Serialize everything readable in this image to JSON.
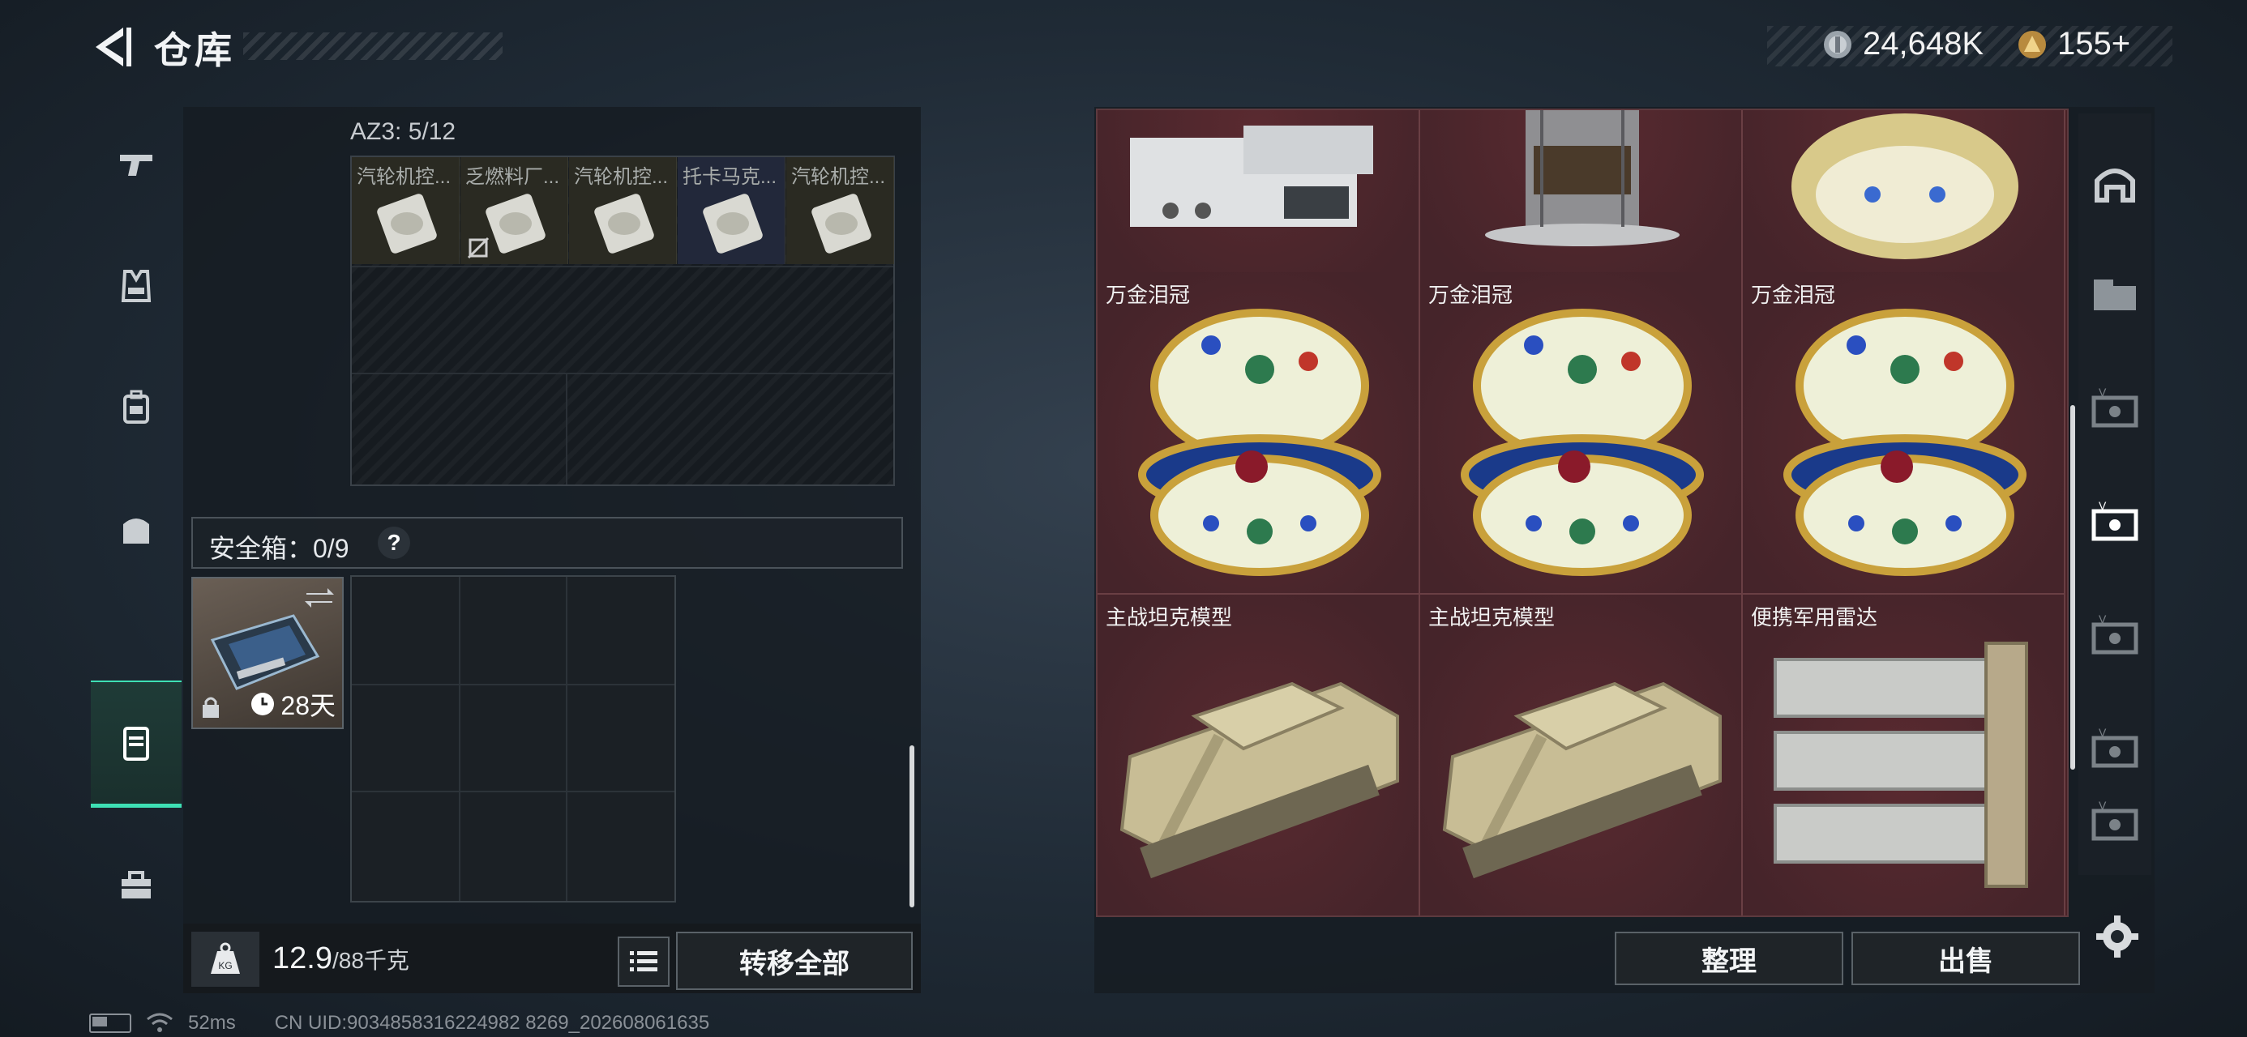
{
  "header": {
    "title": "仓库",
    "currency": [
      {
        "icon": "silver-coin-icon",
        "value": "24,648K"
      },
      {
        "icon": "gold-coin-icon",
        "value": "155+"
      }
    ]
  },
  "left_nav": {
    "items": [
      {
        "name": "weapons-tab",
        "icon": "pistol-icon"
      },
      {
        "name": "armor-tab",
        "icon": "vest-icon"
      },
      {
        "name": "backpack-tab",
        "icon": "backpack-icon"
      },
      {
        "name": "bag-tab",
        "icon": "bag-icon"
      },
      {
        "name": "container-tab",
        "icon": "container-icon",
        "active": true
      },
      {
        "name": "toolbox-tab",
        "icon": "toolbox-icon"
      }
    ]
  },
  "container_az3": {
    "label": "AZ3: 5/12",
    "items": [
      {
        "name": "汽轮机控..."
      },
      {
        "name": "乏燃料厂..."
      },
      {
        "name": "汽轮机控..."
      },
      {
        "name": "托卡马克..."
      },
      {
        "name": "汽轮机控..."
      }
    ]
  },
  "safe_box": {
    "label": "安全箱：0/9",
    "help": "?",
    "timer": "28天"
  },
  "bottom": {
    "weight_current": "12.9",
    "weight_max": "/88千克",
    "weight_icon_text": "KG",
    "transfer_all": "转移全部"
  },
  "stash": {
    "rows": [
      [
        {
          "name": "",
          "kind": "device"
        },
        {
          "name": "",
          "kind": "reactor"
        },
        {
          "name": "",
          "kind": "egg"
        }
      ],
      [
        {
          "name": "万金泪冠",
          "kind": "egg"
        },
        {
          "name": "万金泪冠",
          "kind": "egg"
        },
        {
          "name": "万金泪冠",
          "kind": "egg"
        }
      ],
      [
        {
          "name": "主战坦克模型",
          "kind": "tank"
        },
        {
          "name": "主战坦克模型",
          "kind": "tank"
        },
        {
          "name": "便携军用雷达",
          "kind": "radar"
        }
      ]
    ],
    "sort_label": "整理",
    "sell_label": "出售"
  },
  "right_nav": {
    "items": [
      {
        "icon": "home-shelter-icon"
      },
      {
        "icon": "gti-case-icon"
      },
      {
        "icon": "v-case-icon"
      },
      {
        "icon": "v-case-icon",
        "active": true
      },
      {
        "icon": "v-case-icon"
      },
      {
        "icon": "v-case-icon"
      },
      {
        "icon": "v-case-icon"
      }
    ]
  },
  "statusbar": {
    "ping": "52ms",
    "uid": "CN UID:9034858316224982 8269_202608061635"
  },
  "colors": {
    "accent": "#3ee0b4",
    "stash_bg": "#4a2126"
  }
}
